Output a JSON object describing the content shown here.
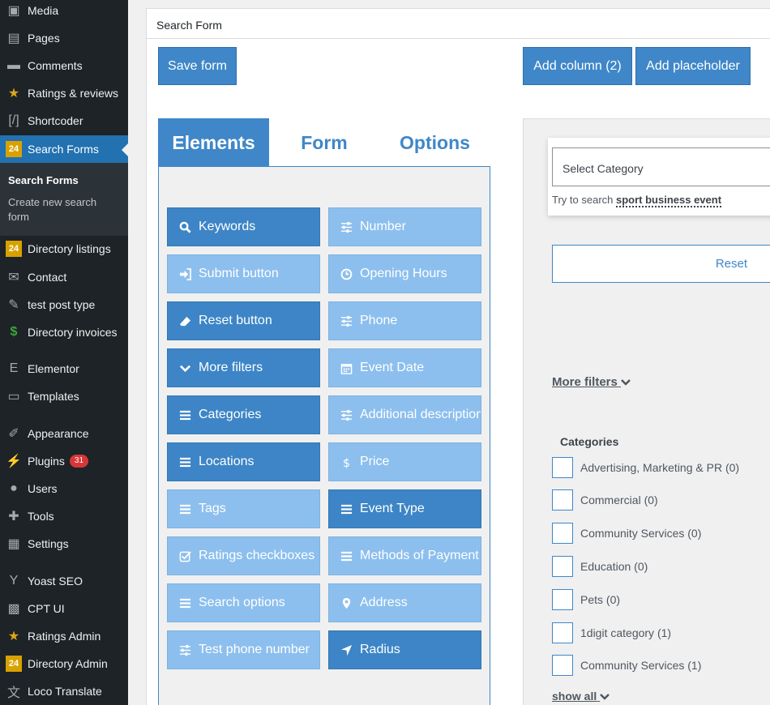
{
  "sidebar": {
    "items": [
      {
        "label": "Media",
        "icon": "media-icon",
        "glyph": "▣"
      },
      {
        "label": "Pages",
        "icon": "pages-icon",
        "glyph": "▤"
      },
      {
        "label": "Comments",
        "icon": "comments-icon",
        "glyph": "▬"
      },
      {
        "label": "Ratings & reviews",
        "icon": "star-icon",
        "glyph": "★"
      },
      {
        "label": "Shortcoder",
        "icon": "shortcode-icon",
        "glyph": "[/]"
      },
      {
        "label": "Search Forms",
        "icon": "plugin-24-icon",
        "glyph": "24"
      },
      {
        "label": "Directory listings",
        "icon": "plugin-24-icon",
        "glyph": "24"
      },
      {
        "label": "Contact",
        "icon": "envelope-icon",
        "glyph": "✉"
      },
      {
        "label": "test post type",
        "icon": "pin-icon",
        "glyph": "✎"
      },
      {
        "label": "Directory invoices",
        "icon": "dollar-icon",
        "glyph": "$"
      },
      {
        "label": "Elementor",
        "icon": "elementor-icon",
        "glyph": "E"
      },
      {
        "label": "Templates",
        "icon": "folder-icon",
        "glyph": "▭"
      },
      {
        "label": "Appearance",
        "icon": "brush-icon",
        "glyph": "✐"
      },
      {
        "label": "Plugins",
        "icon": "plug-icon",
        "glyph": "⚡"
      },
      {
        "label": "Users",
        "icon": "user-icon",
        "glyph": "●"
      },
      {
        "label": "Tools",
        "icon": "wrench-icon",
        "glyph": "✚"
      },
      {
        "label": "Settings",
        "icon": "settings-icon",
        "glyph": "▦"
      },
      {
        "label": "Yoast SEO",
        "icon": "yoast-icon",
        "glyph": "Y"
      },
      {
        "label": "CPT UI",
        "icon": "qr-icon",
        "glyph": "▩"
      },
      {
        "label": "Ratings Admin",
        "icon": "star-icon",
        "glyph": "★"
      },
      {
        "label": "Directory Admin",
        "icon": "plugin-24-icon",
        "glyph": "24"
      },
      {
        "label": "Loco Translate",
        "icon": "translate-icon",
        "glyph": "文"
      }
    ],
    "plugins_badge": "31",
    "submenu": {
      "title": "Search Forms",
      "link": "Create new search form"
    }
  },
  "panel": {
    "title": "Search Form"
  },
  "toolbar": {
    "save": "Save form",
    "add_column": "Add column (2)",
    "add_placeholder": "Add placeholder"
  },
  "tabs": [
    "Elements",
    "Form",
    "Options"
  ],
  "elements": [
    {
      "label": "Keywords",
      "icon": "search-icon",
      "style": "dark"
    },
    {
      "label": "Number",
      "icon": "sliders-icon",
      "style": "light"
    },
    {
      "label": "Submit button",
      "icon": "sign-in-icon",
      "style": "light"
    },
    {
      "label": "Opening Hours",
      "icon": "clock-icon",
      "style": "light"
    },
    {
      "label": "Reset button",
      "icon": "eraser-icon",
      "style": "dark"
    },
    {
      "label": "Phone",
      "icon": "sliders-icon",
      "style": "light"
    },
    {
      "label": "More filters",
      "icon": "chevron-down-icon",
      "style": "dark"
    },
    {
      "label": "Event Date",
      "icon": "calendar-icon",
      "style": "light"
    },
    {
      "label": "Categories",
      "icon": "list-icon",
      "style": "dark"
    },
    {
      "label": "Additional description",
      "icon": "sliders-icon",
      "style": "light"
    },
    {
      "label": "Locations",
      "icon": "list-icon",
      "style": "dark"
    },
    {
      "label": "Price",
      "icon": "dollar-icon",
      "style": "light"
    },
    {
      "label": "Tags",
      "icon": "list-icon",
      "style": "light"
    },
    {
      "label": "Event Type",
      "icon": "list-icon",
      "style": "dark"
    },
    {
      "label": "Ratings checkboxes",
      "icon": "checkbox-icon",
      "style": "light"
    },
    {
      "label": "Methods of Payment",
      "icon": "list-icon",
      "style": "light"
    },
    {
      "label": "Search options",
      "icon": "list-icon",
      "style": "light"
    },
    {
      "label": "Address",
      "icon": "map-marker-icon",
      "style": "light"
    },
    {
      "label": "Test phone number",
      "icon": "sliders-icon",
      "style": "light"
    },
    {
      "label": "Radius",
      "icon": "location-arrow-icon",
      "style": "dark"
    }
  ],
  "preview": {
    "select_placeholder": "Select Category",
    "try_prefix": "Try to search",
    "try_terms": "sport business event",
    "reset": "Reset",
    "more_filters": "More filters",
    "categories_title": "Categories",
    "categories": [
      "Advertising, Marketing & PR (0)",
      "Commercial (0)",
      "Community Services (0)",
      "Education (0)",
      "Pets (0)",
      "1digit category (1)",
      "Community Services (1)"
    ],
    "show_all": "show all"
  },
  "colors": {
    "accent": "#3f87c8",
    "element_dark": "#3d85c6",
    "element_light": "#8cbfee",
    "sidebar_bg": "#1d2327",
    "sidebar_active": "#2271b1",
    "badge": "#d63638"
  }
}
